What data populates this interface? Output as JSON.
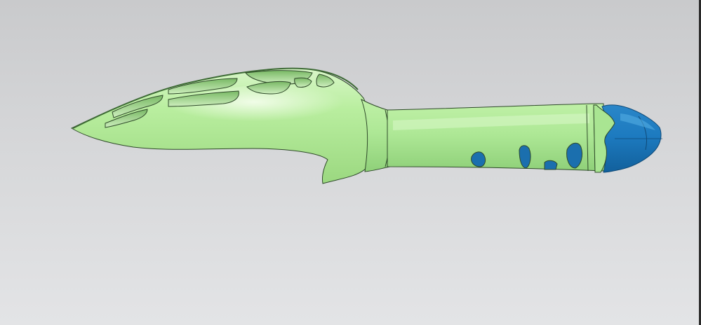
{
  "viewport": {
    "background_top": "#c9cacc",
    "background_bottom": "#e3e4e6"
  },
  "model": {
    "body_color": "#a8e38c",
    "body_highlight": "#dff8cf",
    "body_shadow": "#86c66c",
    "cap_color": "#1b74b8",
    "cap_highlight": "#3a98d8",
    "edge_color": "#2f4a2a"
  }
}
